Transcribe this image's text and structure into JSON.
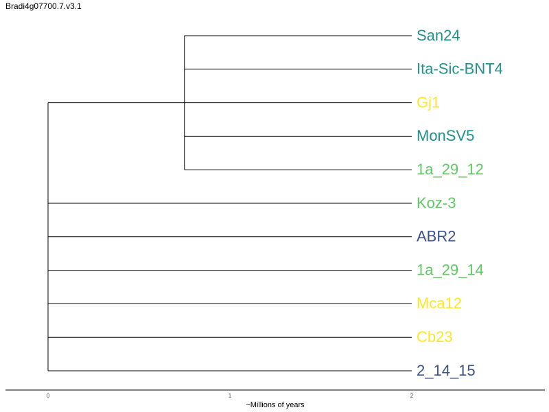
{
  "title": "Bradi4g07700.7.v3.1",
  "axis": {
    "label": "~Millions of years",
    "ticks": [
      "0",
      "1",
      "2"
    ]
  },
  "tree": {
    "leaves": [
      {
        "name": "San24",
        "color": "#21918c"
      },
      {
        "name": "Ita-Sic-BNT4",
        "color": "#21918c"
      },
      {
        "name": "Gj1",
        "color": "#fde725"
      },
      {
        "name": "MonSV5",
        "color": "#21918c"
      },
      {
        "name": "1a_29_12",
        "color": "#5ec962"
      },
      {
        "name": "Koz-3",
        "color": "#5ec962"
      },
      {
        "name": "ABR2",
        "color": "#3b528b"
      },
      {
        "name": "1a_29_14",
        "color": "#5ec962"
      },
      {
        "name": "Mca12",
        "color": "#fde725"
      },
      {
        "name": "Cb23",
        "color": "#fde725"
      },
      {
        "name": "2_14_15",
        "color": "#3b528b"
      }
    ],
    "clade": {
      "members": [
        "San24",
        "Ita-Sic-BNT4",
        "Gj1",
        "MonSV5",
        "1a_29_12"
      ],
      "node_age": 0.75
    },
    "tip_age": 2
  }
}
